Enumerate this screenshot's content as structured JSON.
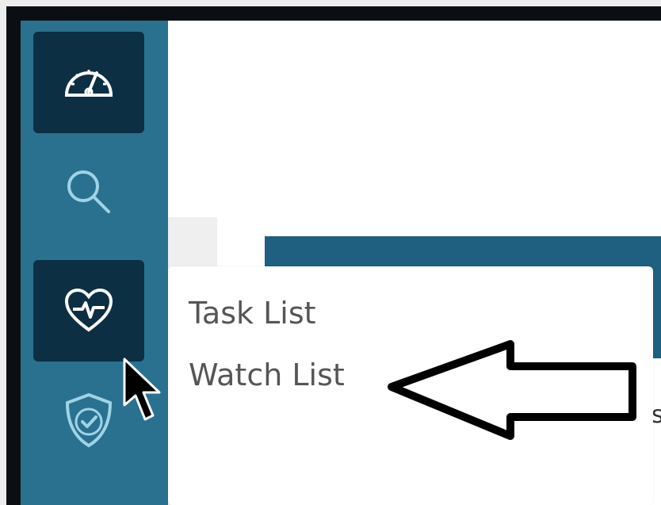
{
  "sidebar": {
    "items": [
      {
        "icon": "dashboard-gauge-icon",
        "active": true
      },
      {
        "icon": "search-icon",
        "active": false
      },
      {
        "icon": "heart-pulse-icon",
        "active": true
      },
      {
        "icon": "shield-check-icon",
        "active": false
      }
    ]
  },
  "menu": {
    "items": [
      {
        "label": "Task List"
      },
      {
        "label": "Watch List"
      }
    ]
  },
  "background": {
    "partial_text": "s"
  },
  "colors": {
    "sidebar": "#2a7190",
    "sidebar_active": "#0c2f44",
    "icon_light": "#9fd3e6",
    "menu_text": "#555555",
    "band": "#1f5f7f"
  }
}
